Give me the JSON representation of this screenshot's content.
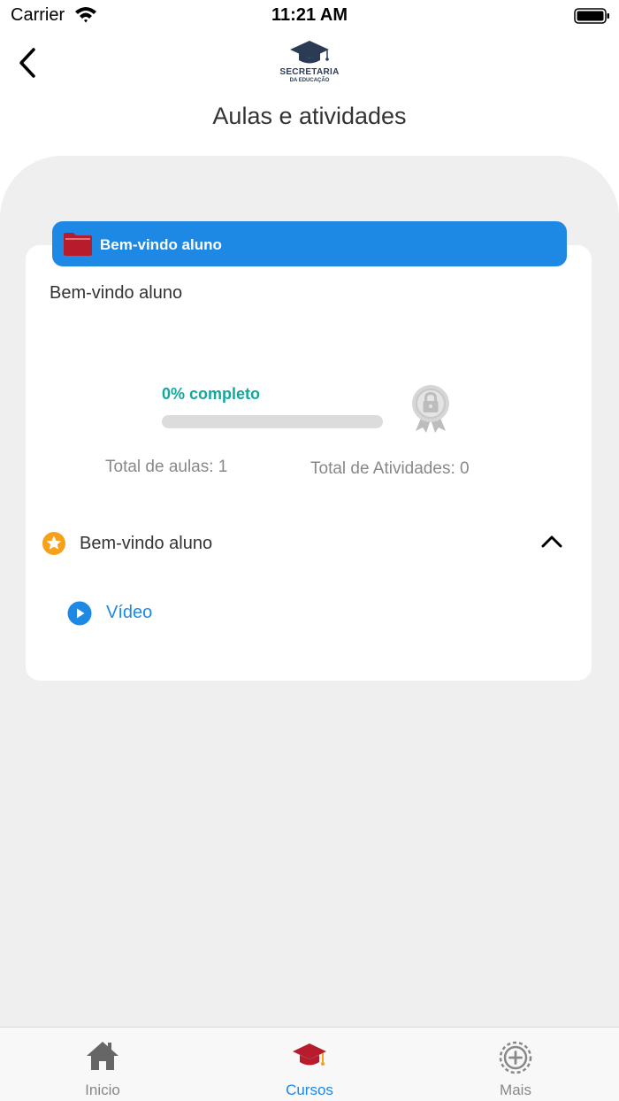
{
  "status_bar": {
    "carrier": "Carrier",
    "time": "11:21 AM"
  },
  "header": {
    "logo_title": "SECRETARIA",
    "logo_subtitle": "DA EDUCAÇÃO",
    "page_title": "Aulas e atividades"
  },
  "module": {
    "header_label": "Bem-vindo aluno",
    "description": "Bem-vindo aluno",
    "progress_label": "0% completo",
    "progress_fraction": 0,
    "total_lessons": "Total de aulas: 1",
    "total_activities": "Total de Atividades: 0"
  },
  "lesson": {
    "title": "Bem-vindo aluno",
    "items": [
      {
        "label": "Vídeo"
      }
    ]
  },
  "tab_bar": {
    "tabs": [
      {
        "label": "Inicio",
        "icon": "home-icon",
        "active": false
      },
      {
        "label": "Cursos",
        "icon": "graduation-cap-icon",
        "active": true
      },
      {
        "label": "Mais",
        "icon": "plus-circle-icon",
        "active": false
      }
    ]
  },
  "colors": {
    "accent": "#1e88e5",
    "progress": "#13a89e",
    "folder": "#b71c2c",
    "star": "#f7a11a"
  }
}
